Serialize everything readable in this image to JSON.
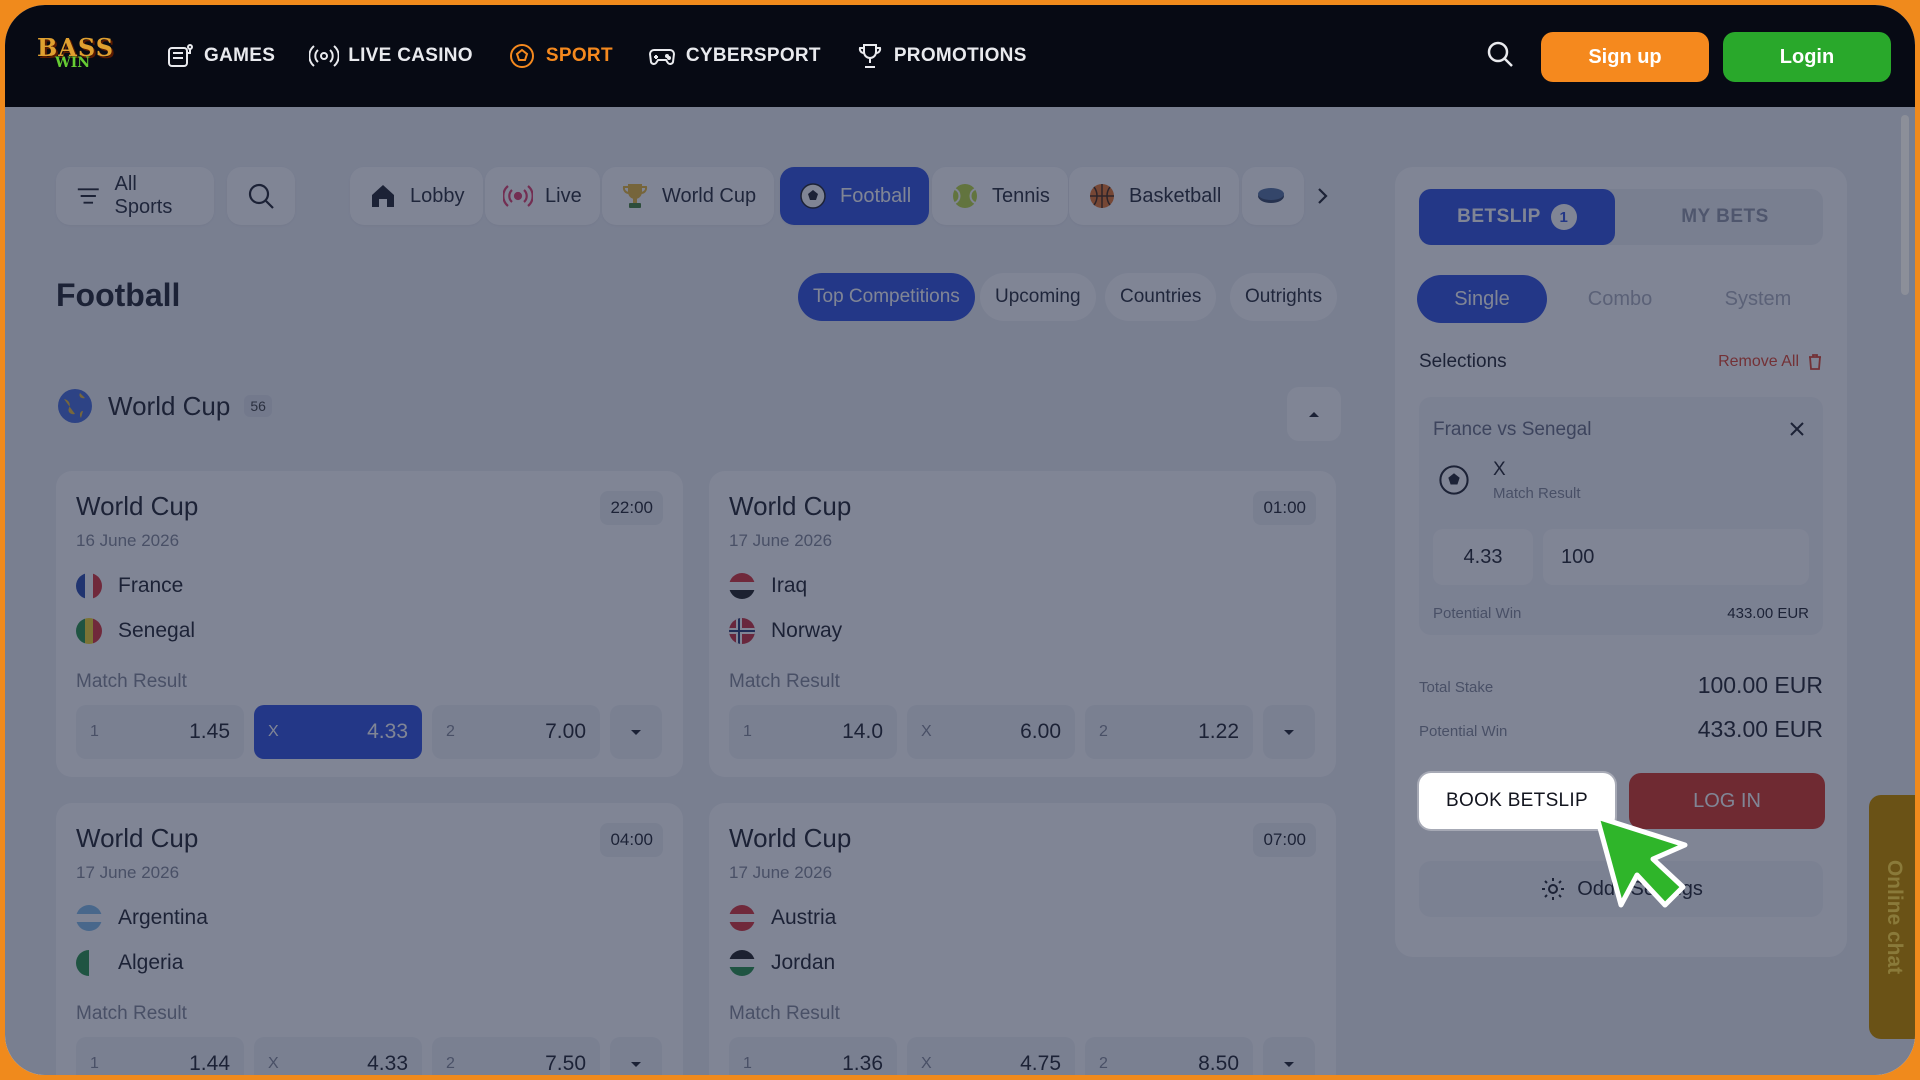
{
  "topbar": {
    "logo_text_1": "BASS",
    "logo_text_2": "WIN",
    "nav": [
      {
        "label": "GAMES",
        "icon": "slot-machine-icon"
      },
      {
        "label": "LIVE CASINO",
        "icon": "live-broadcast-icon"
      },
      {
        "label": "SPORT",
        "icon": "soccer-ball-icon",
        "active": true
      },
      {
        "label": "CYBERSPORT",
        "icon": "gamepad-icon"
      },
      {
        "label": "PROMOTIONS",
        "icon": "trophy-icon"
      }
    ],
    "signup_label": "Sign up",
    "login_label": "Login"
  },
  "sports_bar": {
    "all_sports_label": "All Sports",
    "items": [
      {
        "label": "Lobby",
        "icon": "home-icon"
      },
      {
        "label": "Live",
        "icon": "live-broadcast-icon"
      },
      {
        "label": "World Cup",
        "icon": "trophy-icon"
      },
      {
        "label": "Football",
        "icon": "soccer-ball-icon",
        "active": true
      },
      {
        "label": "Tennis",
        "icon": "tennis-ball-icon"
      },
      {
        "label": "Basketball",
        "icon": "basketball-icon"
      }
    ]
  },
  "page": {
    "title": "Football",
    "filters": [
      "Top Competitions",
      "Upcoming",
      "Countries",
      "Outrights"
    ],
    "section_name": "World Cup",
    "section_count": "56"
  },
  "matches": [
    {
      "competition": "World Cup",
      "date": "16 June 2026",
      "time": "22:00",
      "home": "France",
      "away": "Senegal",
      "market": "Match Result",
      "odds": [
        {
          "label": "1",
          "value": "1.45"
        },
        {
          "label": "X",
          "value": "4.33",
          "selected": true
        },
        {
          "label": "2",
          "value": "7.00"
        }
      ]
    },
    {
      "competition": "World Cup",
      "date": "17 June 2026",
      "time": "01:00",
      "home": "Iraq",
      "away": "Norway",
      "market": "Match Result",
      "odds": [
        {
          "label": "1",
          "value": "14.0"
        },
        {
          "label": "X",
          "value": "6.00"
        },
        {
          "label": "2",
          "value": "1.22"
        }
      ]
    },
    {
      "competition": "World Cup",
      "date": "17 June 2026",
      "time": "04:00",
      "home": "Argentina",
      "away": "Algeria",
      "market": "Match Result",
      "odds": [
        {
          "label": "1",
          "value": "1.44"
        },
        {
          "label": "X",
          "value": "4.33"
        },
        {
          "label": "2",
          "value": "7.50"
        }
      ]
    },
    {
      "competition": "World Cup",
      "date": "17 June 2026",
      "time": "07:00",
      "home": "Austria",
      "away": "Jordan",
      "market": "Match Result",
      "odds": [
        {
          "label": "1",
          "value": "1.36"
        },
        {
          "label": "X",
          "value": "4.75"
        },
        {
          "label": "2",
          "value": "8.50"
        }
      ]
    }
  ],
  "betslip": {
    "tab_betslip": "BETSLIP",
    "tab_count": "1",
    "tab_mybets": "MY BETS",
    "modes": [
      "Single",
      "Combo",
      "System"
    ],
    "selections_label": "Selections",
    "remove_all_label": "Remove All",
    "selection": {
      "match": "France vs Senegal",
      "pick": "X",
      "market": "Match Result",
      "odd": "4.33",
      "stake": "100",
      "potential_win_label": "Potential Win",
      "potential_win_value": "433.00 EUR"
    },
    "total_stake_label": "Total Stake",
    "total_stake_value": "100.00 EUR",
    "potential_win_label": "Potential Win",
    "potential_win_value": "433.00 EUR",
    "book_label": "BOOK BETSLIP",
    "login_label": "LOG IN",
    "odds_settings_label": "Odds Settings"
  },
  "chat_label": "Online chat",
  "colors": {
    "accent": "#2346dd",
    "brand_orange": "#f5891e",
    "login_green": "#29a82b",
    "danger": "#d72814"
  }
}
